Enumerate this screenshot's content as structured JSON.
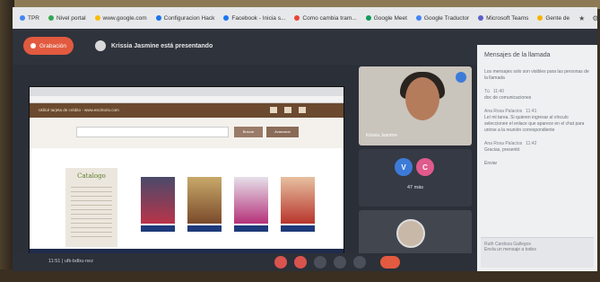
{
  "browser": {
    "bookmarks": [
      "TPR",
      "Nivel portal",
      "www.google.com",
      "Configuracion Hack",
      "Facebook - Inicia s...",
      "Como cambia tram...",
      "Google Meet",
      "Google Traductor",
      "Microsoft Teams",
      "Gente de"
    ],
    "bookmark_colors": [
      "#4285f4",
      "#34a853",
      "#fbbc05",
      "#1a73e8",
      "#1877f2",
      "#ea4335",
      "#0f9d58",
      "#4285f4",
      "#5b5fc7",
      "#f4b400"
    ]
  },
  "meeting": {
    "record_label": "Grabación",
    "presenting_label": "Krissia Jasmine está presentando",
    "time": "11:51",
    "meeting_code": "ufk-bdbu-nez",
    "accent_colors": {
      "record": "#e25a3f",
      "end_call": "#e25a3f",
      "controls": "#d9534f"
    }
  },
  "shared_screen": {
    "site_header": "Utilicé tarjeta de crédito - www.escritorio.com",
    "search_button": "Buscar",
    "advanced_button": "Avanzado",
    "catalog_label": "Catalogo"
  },
  "chat": {
    "title": "Mensajes de la llamada",
    "notice": "Los mensajes solo son visibles para las personas de la llamada",
    "messages": [
      {
        "name": "Tú",
        "time": "11:40",
        "text": "doc de comunicaciones"
      },
      {
        "name": "Ana Rosa Palacios",
        "time": "11:41",
        "text": "Leí mi tarea. Si quieren ingresar al vínculo seleccionen el enlace que aparece en el chat para unirse a la reunión correspondiente"
      },
      {
        "name": "Ana Rosa Palacios",
        "time": "11:42",
        "text": "Gracias, presentó"
      },
      {
        "name": "",
        "time": "",
        "text": "Enviar"
      }
    ],
    "input_author": "Ruth Cardoza Gallegos",
    "input_placeholder": "Envía un mensaje a todos"
  },
  "participants": {
    "main_name": "Krissia Jasmine",
    "group_initials": [
      "V",
      "C"
    ],
    "group_colors": [
      "#3d7bd9",
      "#e05a8c"
    ],
    "group_count": "47 más"
  }
}
